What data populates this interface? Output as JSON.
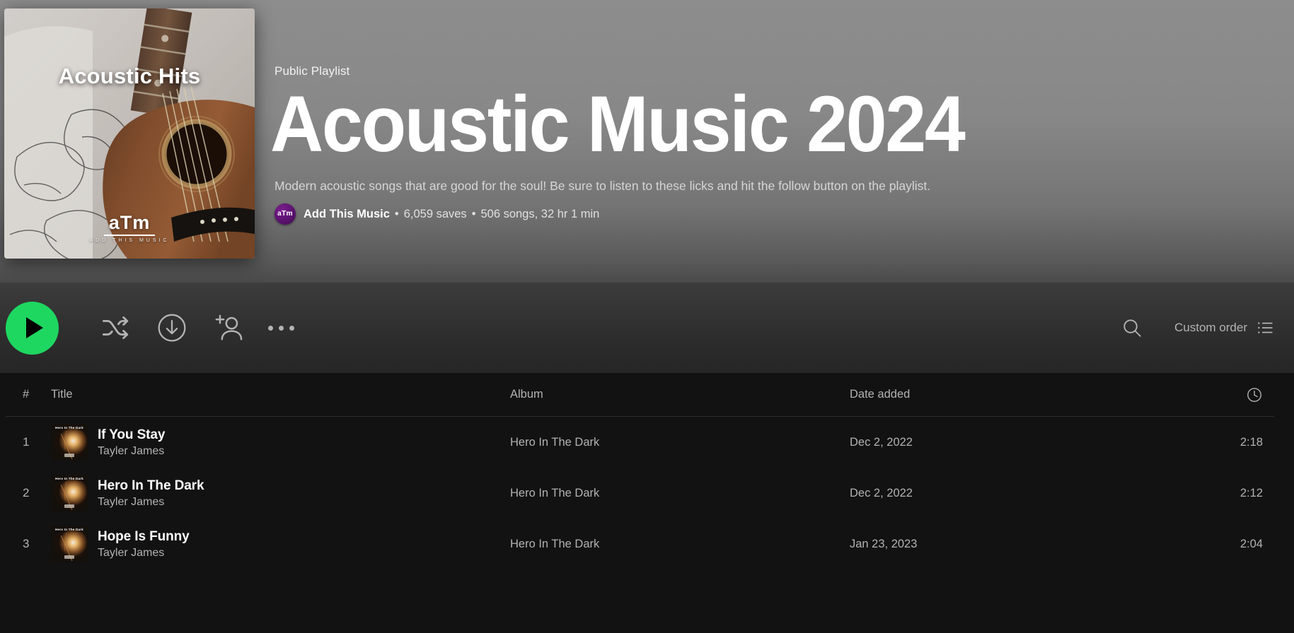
{
  "header": {
    "playlist_type": "Public Playlist",
    "playlist_name": "Acoustic Music 2024",
    "description": "Modern acoustic songs that are good for the soul! Be sure to listen to these licks and hit the follow button on the playlist.",
    "owner": "Add This Music",
    "owner_avatar_text": "aTm",
    "separator": "•",
    "saves": "6,059 saves",
    "songs_summary": "506 songs, 32 hr 1 min",
    "cover": {
      "title": "Acoustic Hits",
      "logo_mark": "aTm",
      "logo_sub": "ADD THIS MUSIC"
    }
  },
  "toolbar": {
    "play_label": "Play",
    "shuffle_label": "Shuffle",
    "download_label": "Download",
    "add_user_label": "Add user to playlist",
    "more_label": "More options",
    "search_label": "Search in playlist",
    "sort_label": "Custom order",
    "list_view_label": "List view"
  },
  "table": {
    "columns": {
      "number": "#",
      "title": "Title",
      "album": "Album",
      "date_added": "Date added",
      "duration": "duration-clock-icon"
    },
    "rows": [
      {
        "number": "1",
        "title": "If You Stay",
        "artist": "Tayler James",
        "album": "Hero In The Dark",
        "date_added": "Dec 2, 2022",
        "duration": "2:18",
        "art_caption": "Hero In The Dark"
      },
      {
        "number": "2",
        "title": "Hero In The Dark",
        "artist": "Tayler James",
        "album": "Hero In The Dark",
        "date_added": "Dec 2, 2022",
        "duration": "2:12",
        "art_caption": "Hero In The Dark"
      },
      {
        "number": "3",
        "title": "Hope Is Funny",
        "artist": "Tayler James",
        "album": "Hero In The Dark",
        "date_added": "Jan 23, 2023",
        "duration": "2:04",
        "art_caption": "Hero In The Dark"
      }
    ]
  },
  "colors": {
    "accent_green": "#1ed760",
    "background": "#121212",
    "text_primary": "#ffffff",
    "text_secondary": "#b3b3b3",
    "avatar_purple": "#5c1270"
  }
}
